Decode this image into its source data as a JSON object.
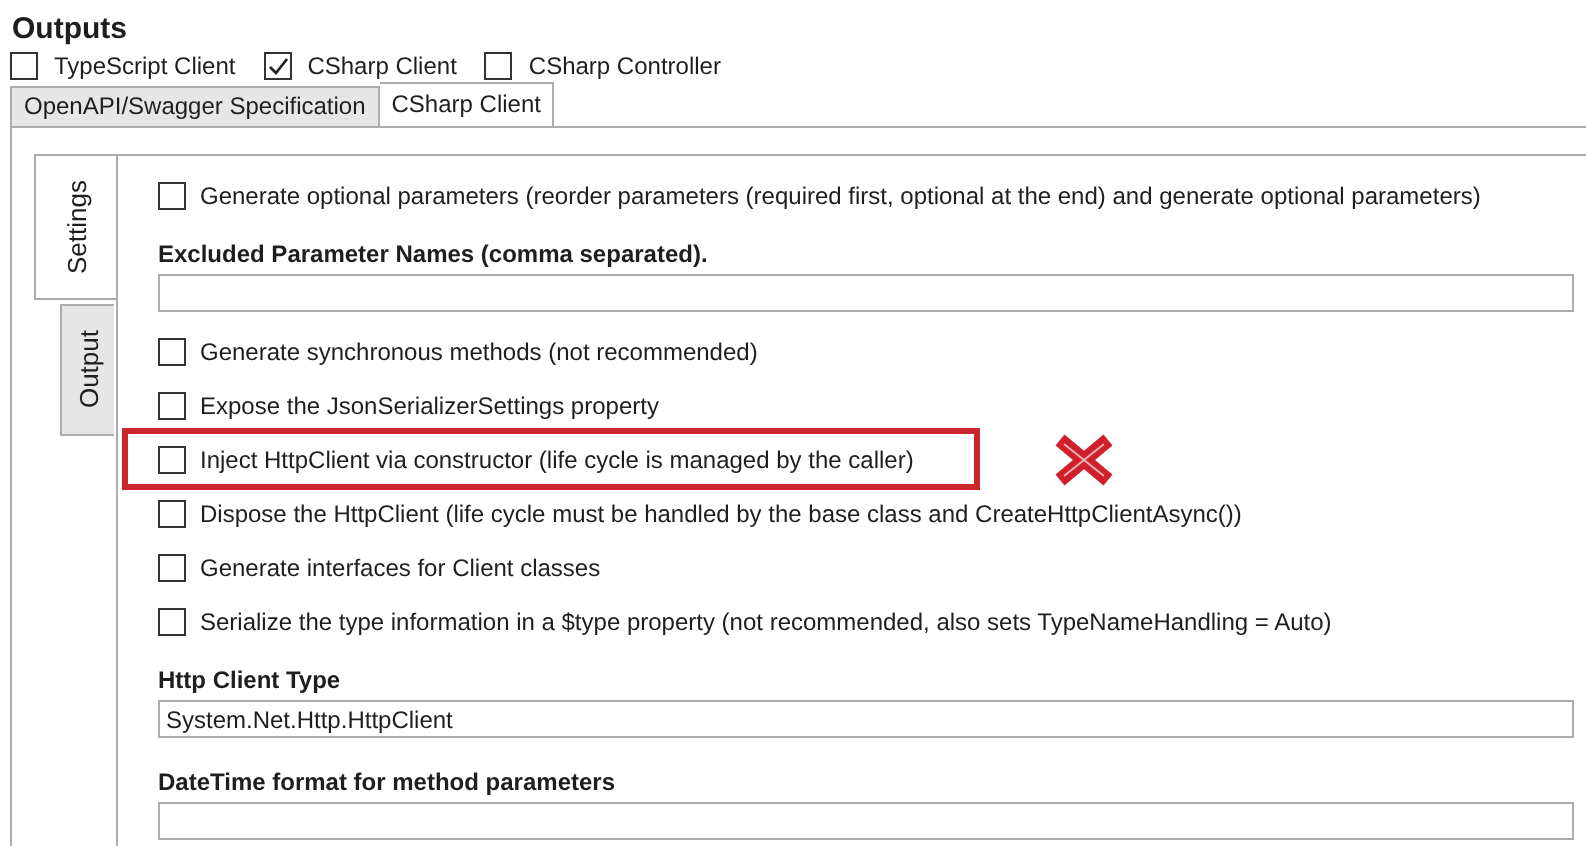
{
  "title": "Outputs",
  "outputs": [
    {
      "label": "TypeScript Client",
      "checked": false
    },
    {
      "label": "CSharp Client",
      "checked": true
    },
    {
      "label": "CSharp Controller",
      "checked": false
    }
  ],
  "tabs": [
    {
      "label": "OpenAPI/Swagger Specification",
      "selected": false
    },
    {
      "label": "CSharp Client",
      "selected": true
    }
  ],
  "side_tabs": [
    {
      "label": "Settings",
      "selected": true
    },
    {
      "label": "Output",
      "selected": false
    }
  ],
  "settings": [
    {
      "kind": "checkbox",
      "label": "Generate optional parameters (reorder parameters (required first, optional at the end) and generate optional parameters)",
      "checked": false,
      "highlighted": false
    },
    {
      "kind": "heading",
      "label": "Excluded Parameter Names (comma separated)."
    },
    {
      "kind": "field"
    },
    {
      "kind": "checkbox",
      "label": "Generate synchronous methods (not recommended)",
      "checked": false,
      "highlighted": false
    },
    {
      "kind": "checkbox",
      "label": "Expose the JsonSerializerSettings property",
      "checked": false,
      "highlighted": false
    },
    {
      "kind": "checkbox",
      "label": "Inject HttpClient via constructor (life cycle is managed by the caller)",
      "checked": false,
      "highlighted": true
    },
    {
      "kind": "checkbox",
      "label": "Dispose the HttpClient (life cycle must be handled by the base class and CreateHttpClientAsync())",
      "checked": false,
      "highlighted": false
    },
    {
      "kind": "checkbox",
      "label": "Generate interfaces for Client classes",
      "checked": false,
      "highlighted": false
    },
    {
      "kind": "checkbox",
      "label": "Serialize the type information in a $type property (not recommended, also sets TypeNameHandling = Auto)",
      "checked": false,
      "highlighted": false
    },
    {
      "kind": "heading",
      "label": "Http Client Type"
    },
    {
      "kind": "field",
      "value": "System.Net.Http.HttpClient"
    },
    {
      "kind": "heading",
      "label": "DateTime format for method parameters"
    },
    {
      "kind": "field"
    }
  ]
}
